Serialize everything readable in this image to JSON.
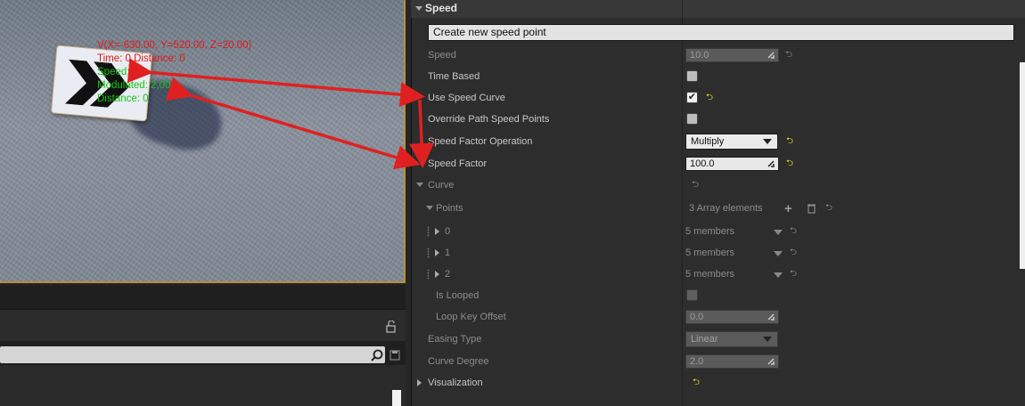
{
  "viewport": {
    "info_lines": [
      {
        "text": "V(X=-630.00, Y=520.00, Z=20.00)",
        "color": "#e01a1a"
      },
      {
        "text": "Time: 0 Distance: 0",
        "color": "#e01a1a"
      },
      {
        "text": "Speed: 20",
        "color": "#18c318"
      },
      {
        "text": "Modulated: 2,000",
        "color": "#18c318"
      },
      {
        "text": "Distance: 0",
        "color": "#18c318"
      }
    ],
    "annotation_color": "#e02020"
  },
  "lower_left": {
    "search_placeholder": "",
    "icons": [
      "lock-icon",
      "search-icon",
      "save-icon"
    ]
  },
  "details": {
    "section_title": "Speed",
    "create_button": "Create new speed point",
    "rows": {
      "speed": {
        "label": "Speed",
        "value": "10.0"
      },
      "time_based": {
        "label": "Time Based",
        "checked": false
      },
      "use_speed_curve": {
        "label": "Use Speed Curve",
        "checked": true
      },
      "override_path": {
        "label": "Override Path Speed Points",
        "checked": false
      },
      "speed_factor_op": {
        "label": "Speed Factor Operation",
        "value": "Multiply"
      },
      "speed_factor": {
        "label": "Speed Factor",
        "value": "100.0"
      },
      "curve": {
        "label": "Curve"
      },
      "points": {
        "label": "Points",
        "value": "3 Array elements"
      },
      "point_items": [
        {
          "index": "0",
          "value": "5 members"
        },
        {
          "index": "1",
          "value": "5 members"
        },
        {
          "index": "2",
          "value": "5 members"
        }
      ],
      "is_looped": {
        "label": "Is Looped",
        "checked": false
      },
      "loop_key_offset": {
        "label": "Loop Key Offset",
        "value": "0.0"
      },
      "easing_type": {
        "label": "Easing Type",
        "value": "Linear"
      },
      "curve_degree": {
        "label": "Curve Degree",
        "value": "2.0"
      },
      "visualization": {
        "label": "Visualization"
      }
    }
  }
}
